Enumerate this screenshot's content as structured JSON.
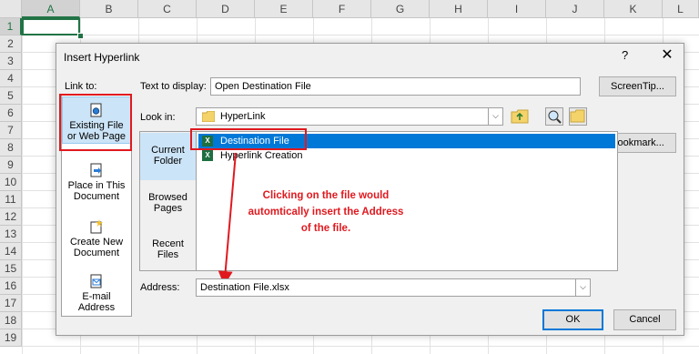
{
  "sheet": {
    "columns": [
      "A",
      "B",
      "C",
      "D",
      "E",
      "F",
      "G",
      "H",
      "I",
      "J",
      "K",
      "L"
    ],
    "rows": [
      "1",
      "2",
      "3",
      "4",
      "5",
      "6",
      "7",
      "8",
      "9",
      "10",
      "11",
      "12",
      "13",
      "14",
      "15",
      "16",
      "17",
      "18",
      "19"
    ]
  },
  "dialog": {
    "title": "Insert Hyperlink",
    "help": "?",
    "close": "✕",
    "link_to_label": "Link to:",
    "text_to_display_label": "Text to display:",
    "text_to_display_value": "Open Destination File",
    "screentip_label": "ScreenTip...",
    "look_in_label": "Look in:",
    "look_in_value": "HyperLink",
    "bookmark_label": "Bookmark...",
    "address_label": "Address:",
    "address_value": "Destination File.xlsx",
    "ok_label": "OK",
    "cancel_label": "Cancel",
    "link_to_items": [
      {
        "line1": "Existing File",
        "line2": "or Web Page"
      },
      {
        "line1": "Place in This",
        "line2": "Document"
      },
      {
        "line1": "Create New",
        "line2": "Document"
      },
      {
        "line1": "E-mail",
        "line2": "Address"
      }
    ],
    "sub_items": [
      {
        "line1": "Current",
        "line2": "Folder"
      },
      {
        "line1": "Browsed",
        "line2": "Pages"
      },
      {
        "line1": "Recent",
        "line2": "Files"
      }
    ],
    "files": [
      "Destination File",
      "Hyperlink Creation"
    ]
  },
  "annotation": {
    "line1": "Clicking on the file would",
    "line2": "automtically insert the Address",
    "line3": "of the file.",
    "color": "#e0191f"
  }
}
